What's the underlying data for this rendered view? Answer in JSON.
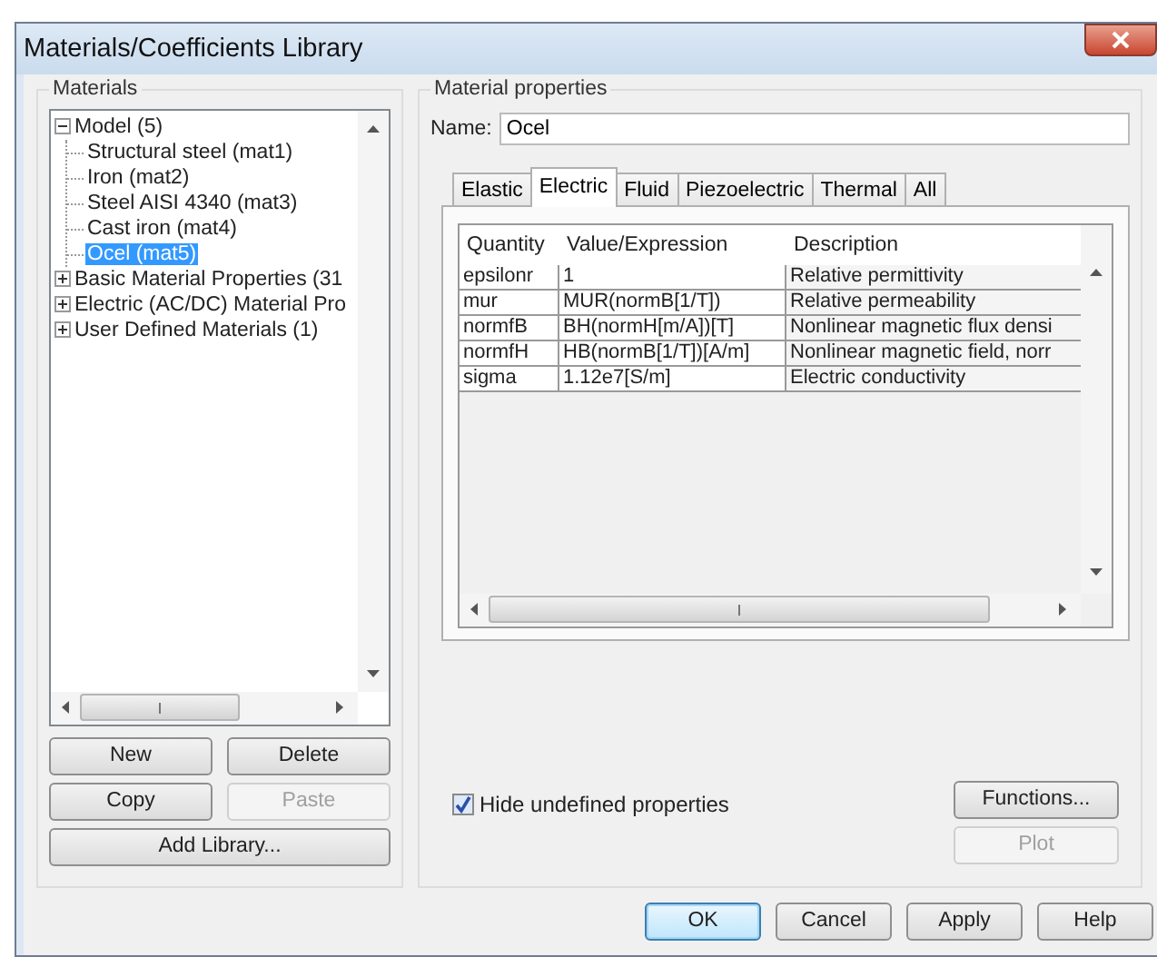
{
  "window": {
    "title": "Materials/Coefficients Library"
  },
  "materials": {
    "label": "Materials",
    "tree": [
      {
        "label": "Model (5)",
        "expanded": true,
        "selected": false,
        "children": [
          {
            "label": "Structural steel (mat1)",
            "selected": false
          },
          {
            "label": "Iron (mat2)",
            "selected": false
          },
          {
            "label": "Steel AISI 4340 (mat3)",
            "selected": false
          },
          {
            "label": "Cast iron (mat4)",
            "selected": false
          },
          {
            "label": "Ocel (mat5)",
            "selected": true
          }
        ]
      },
      {
        "label": "Basic Material Properties (31",
        "expanded": false,
        "selected": false
      },
      {
        "label": "Electric (AC/DC) Material Pro",
        "expanded": false,
        "selected": false
      },
      {
        "label": "User Defined Materials (1)",
        "expanded": false,
        "selected": false
      }
    ],
    "buttons": [
      {
        "label": "New",
        "disabled": false
      },
      {
        "label": "Delete",
        "disabled": false
      },
      {
        "label": "Copy",
        "disabled": false
      },
      {
        "label": "Paste",
        "disabled": true
      },
      {
        "label": "Add Library...",
        "disabled": false
      }
    ]
  },
  "properties": {
    "label": "Material properties",
    "name_label": "Name:",
    "name_value": "Ocel",
    "tabs": [
      {
        "label": "Elastic",
        "selected": false
      },
      {
        "label": "Electric",
        "selected": true
      },
      {
        "label": "Fluid",
        "selected": false
      },
      {
        "label": "Piezoelectric",
        "selected": false
      },
      {
        "label": "Thermal",
        "selected": false
      },
      {
        "label": "All",
        "selected": false
      }
    ],
    "table": {
      "columns": [
        "Quantity",
        "Value/Expression",
        "Description"
      ],
      "rows": [
        [
          "epsilonr",
          "1",
          "Relative permittivity"
        ],
        [
          "mur",
          "MUR(normB[1/T])",
          "Relative permeability"
        ],
        [
          "normfB",
          "BH(normH[m/A])[T]",
          "Nonlinear magnetic flux densi"
        ],
        [
          "normfH",
          "HB(normB[1/T])[A/m]",
          "Nonlinear magnetic field, norr"
        ],
        [
          "sigma",
          "1.12e7[S/m]",
          "Electric conductivity"
        ]
      ]
    },
    "hide_undefined": {
      "label": "Hide undefined properties",
      "checked": true
    },
    "buttons": [
      {
        "label": "Functions...",
        "disabled": false
      },
      {
        "label": "Plot",
        "disabled": true
      }
    ]
  },
  "footer_buttons": [
    {
      "label": "OK",
      "default": true
    },
    {
      "label": "Cancel",
      "default": false
    },
    {
      "label": "Apply",
      "default": false
    },
    {
      "label": "Help",
      "default": false
    }
  ]
}
